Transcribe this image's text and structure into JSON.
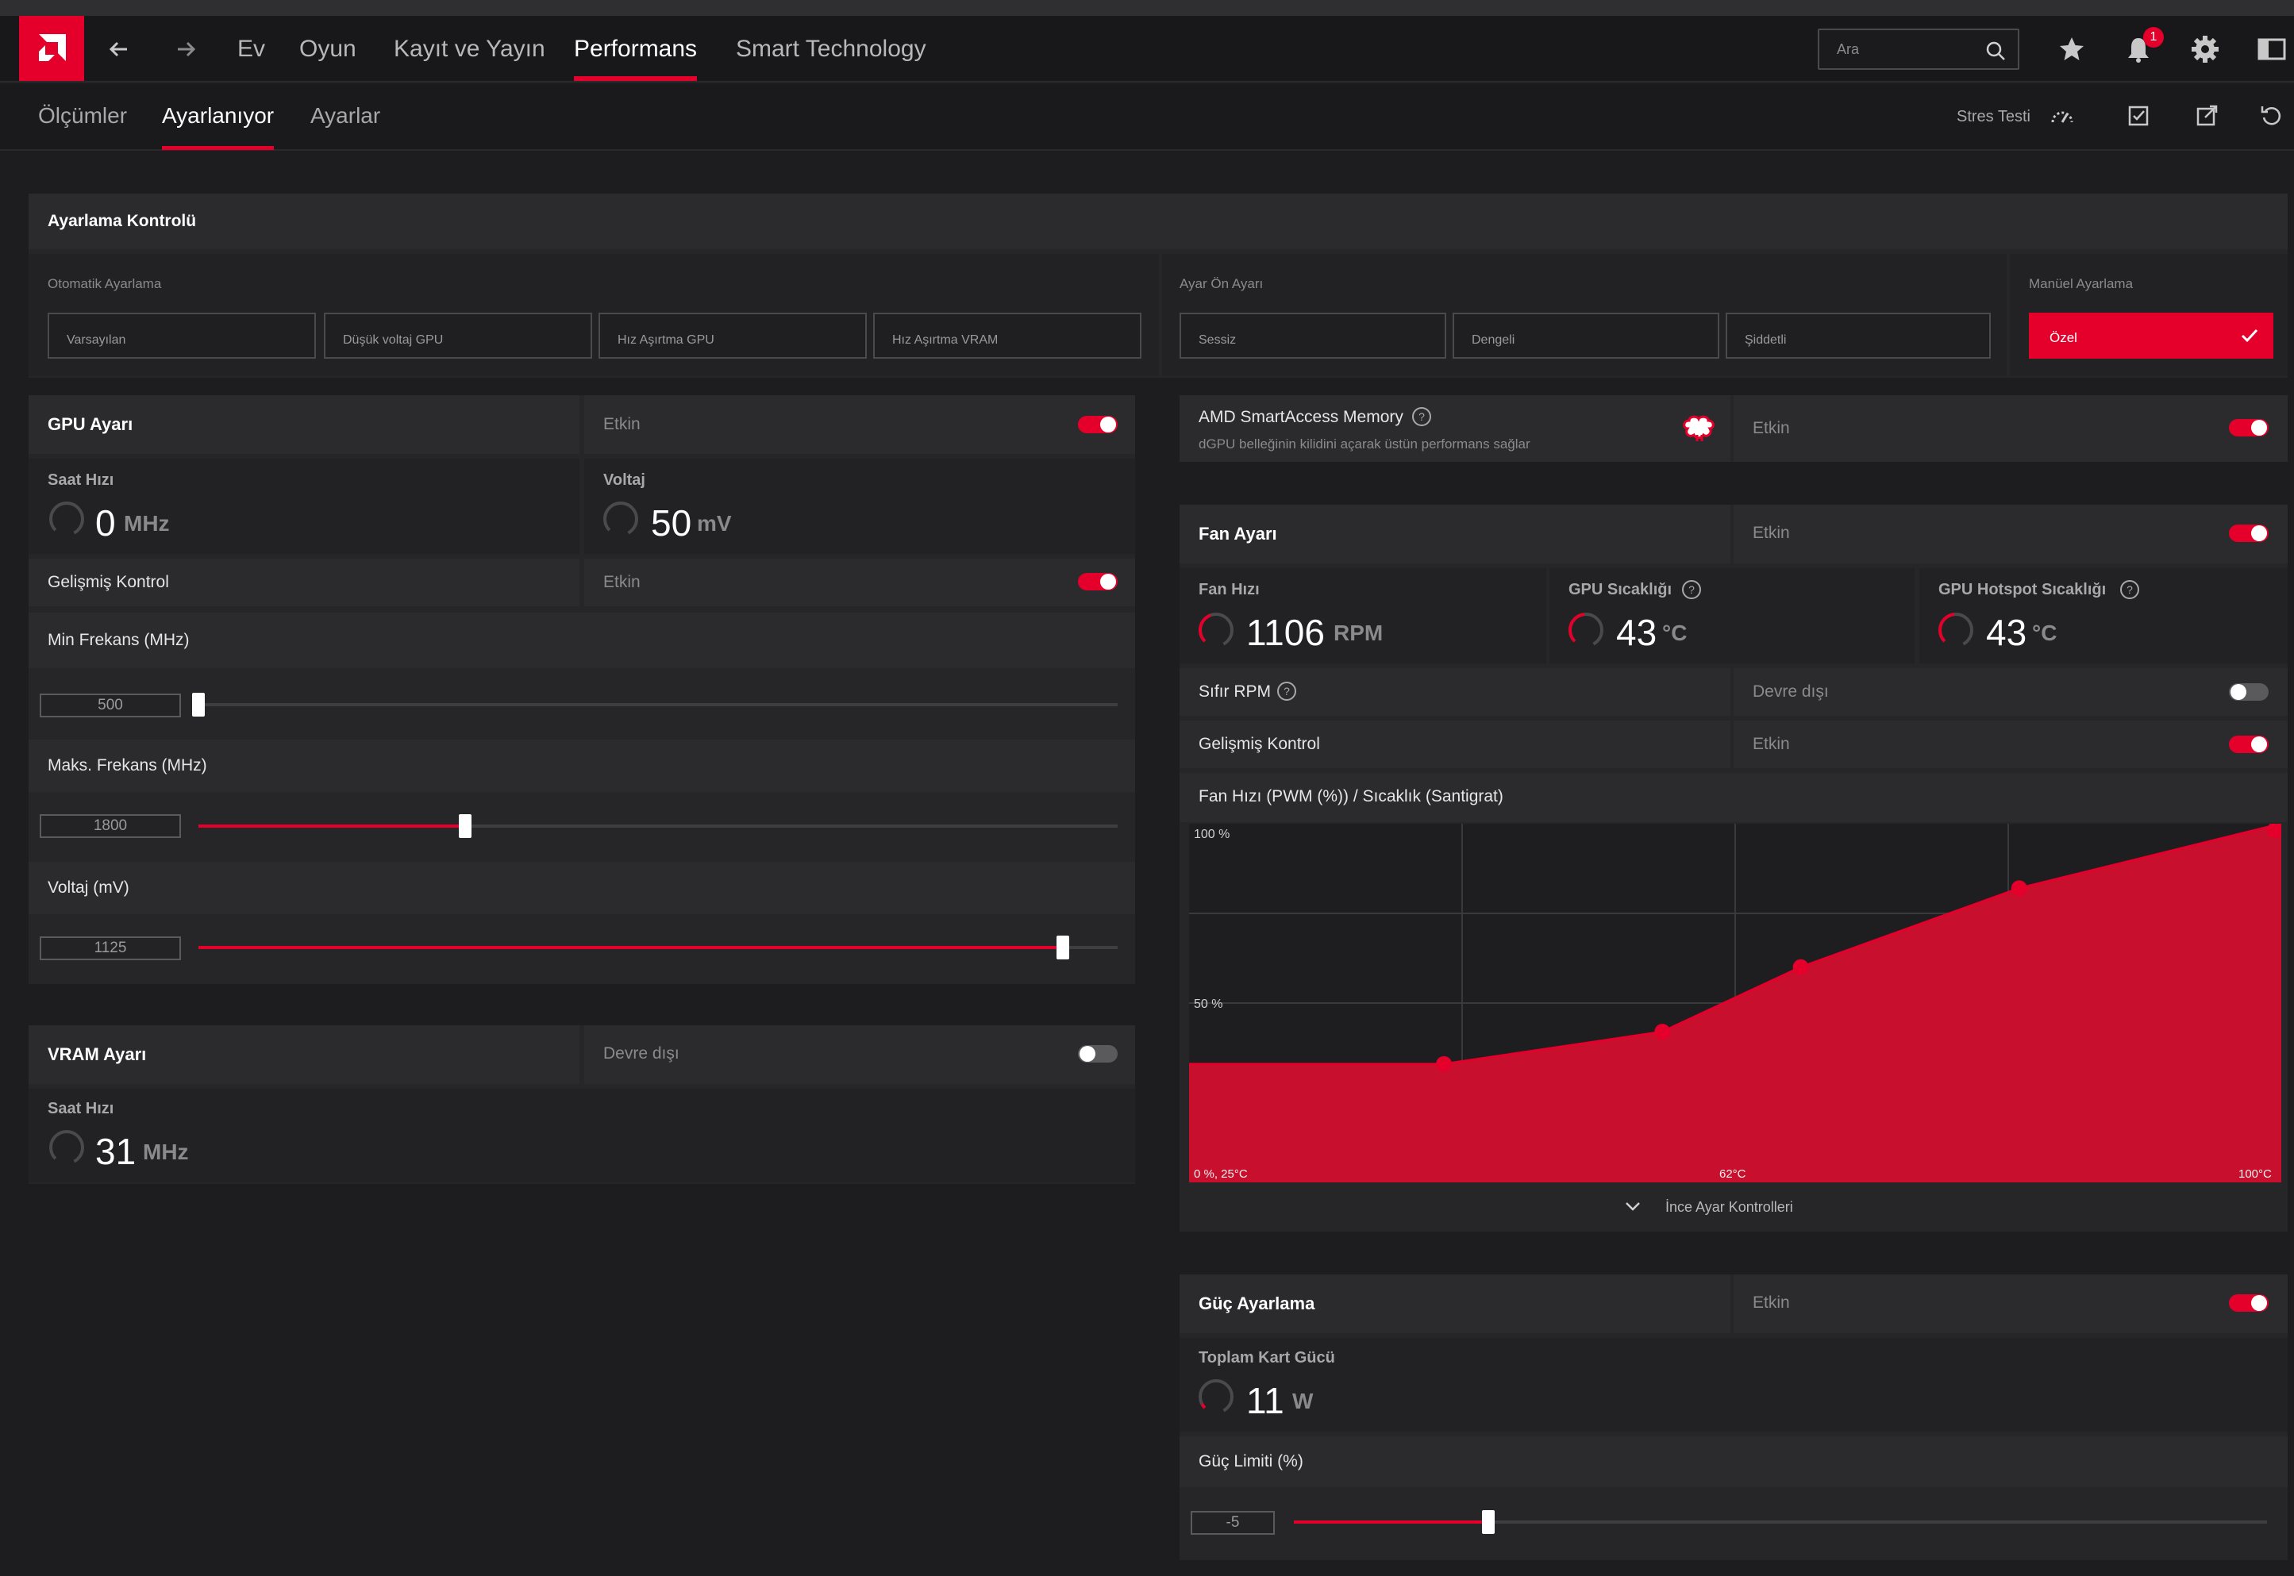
{
  "topnav": {
    "items": [
      "Ev",
      "Oyun",
      "Kayıt ve Yayın",
      "Performans",
      "Smart Technology"
    ],
    "active": "Performans",
    "search_placeholder": "Ara",
    "notification_count": "1"
  },
  "subnav": {
    "items": [
      "Ölçümler",
      "Ayarlanıyor",
      "Ayarlar"
    ],
    "active": "Ayarlanıyor",
    "stres_testi": "Stres Testi"
  },
  "tuning_control": {
    "title": "Ayarlama Kontrolü",
    "auto_label": "Otomatik Ayarlama",
    "auto_buttons": [
      "Varsayılan",
      "Düşük voltaj GPU",
      "Hız Aşırtma GPU",
      "Hız Aşırtma VRAM"
    ],
    "preset_label": "Ayar Ön Ayarı",
    "preset_buttons": [
      "Sessiz",
      "Dengeli",
      "Şiddetli"
    ],
    "manual_label": "Manüel Ayarlama",
    "manual_button": "Özel"
  },
  "gpu": {
    "title": "GPU Ayarı",
    "status": "Etkin",
    "clock_label": "Saat Hızı",
    "clock_value": "0",
    "clock_unit": "MHz",
    "voltage_label": "Voltaj",
    "voltage_value": "50",
    "voltage_unit": "mV",
    "advanced_label": "Gelişmiş Kontrol",
    "advanced_status": "Etkin",
    "min_freq_label": "Min Frekans (MHz)",
    "min_freq_value": "500",
    "min_freq_level": 0.0,
    "max_freq_label": "Maks. Frekans (MHz)",
    "max_freq_value": "1800",
    "max_freq_level": 0.29,
    "volt_label": "Voltaj (mV)",
    "volt_value": "1125",
    "volt_level": 0.94
  },
  "vram": {
    "title": "VRAM Ayarı",
    "status": "Devre dışı",
    "clock_label": "Saat Hızı",
    "clock_value": "31",
    "clock_unit": "MHz"
  },
  "sam": {
    "title": "AMD SmartAccess Memory",
    "desc": "dGPU belleğinin kilidini açarak üstün performans sağlar",
    "status": "Etkin"
  },
  "fan": {
    "title": "Fan Ayarı",
    "status": "Etkin",
    "speed_label": "Fan Hızı",
    "speed_value": "1106",
    "speed_unit": "RPM",
    "temp_label": "GPU Sıcaklığı",
    "temp_value": "43",
    "temp_unit": "°C",
    "hotspot_label": "GPU Hotspot Sıcaklığı",
    "hotspot_value": "43",
    "hotspot_unit": "°C",
    "zero_rpm_label": "Sıfır RPM",
    "zero_rpm_status": "Devre dışı",
    "advanced_label": "Gelişmiş Kontrol",
    "advanced_status": "Etkin",
    "curve_title": "Fan Hızı (PWM (%)) / Sıcaklık (Santigrat)",
    "fine_tune": "İnce Ayar Kontrolleri"
  },
  "chart_data": {
    "type": "area",
    "title": "Fan Hızı (PWM (%)) / Sıcaklık (Santigrat)",
    "y_tick_labels": [
      "100 %",
      "50 %"
    ],
    "x_tick_labels": [
      "0 %, 25°C",
      "62°C",
      "100°C"
    ],
    "xlim": [
      25,
      100
    ],
    "ylim": [
      0,
      100
    ],
    "x": [
      25,
      42.5,
      57.5,
      67,
      82,
      100
    ],
    "y": [
      33,
      33,
      42,
      60,
      82,
      100
    ]
  },
  "power": {
    "title": "Güç Ayarlama",
    "status": "Etkin",
    "total_label": "Toplam Kart Gücü",
    "total_value": "11",
    "total_unit": "W",
    "limit_label": "Güç Limiti (%)",
    "limit_value": "-5",
    "limit_level": 0.2
  },
  "colors": {
    "accent": "#e4002b"
  }
}
